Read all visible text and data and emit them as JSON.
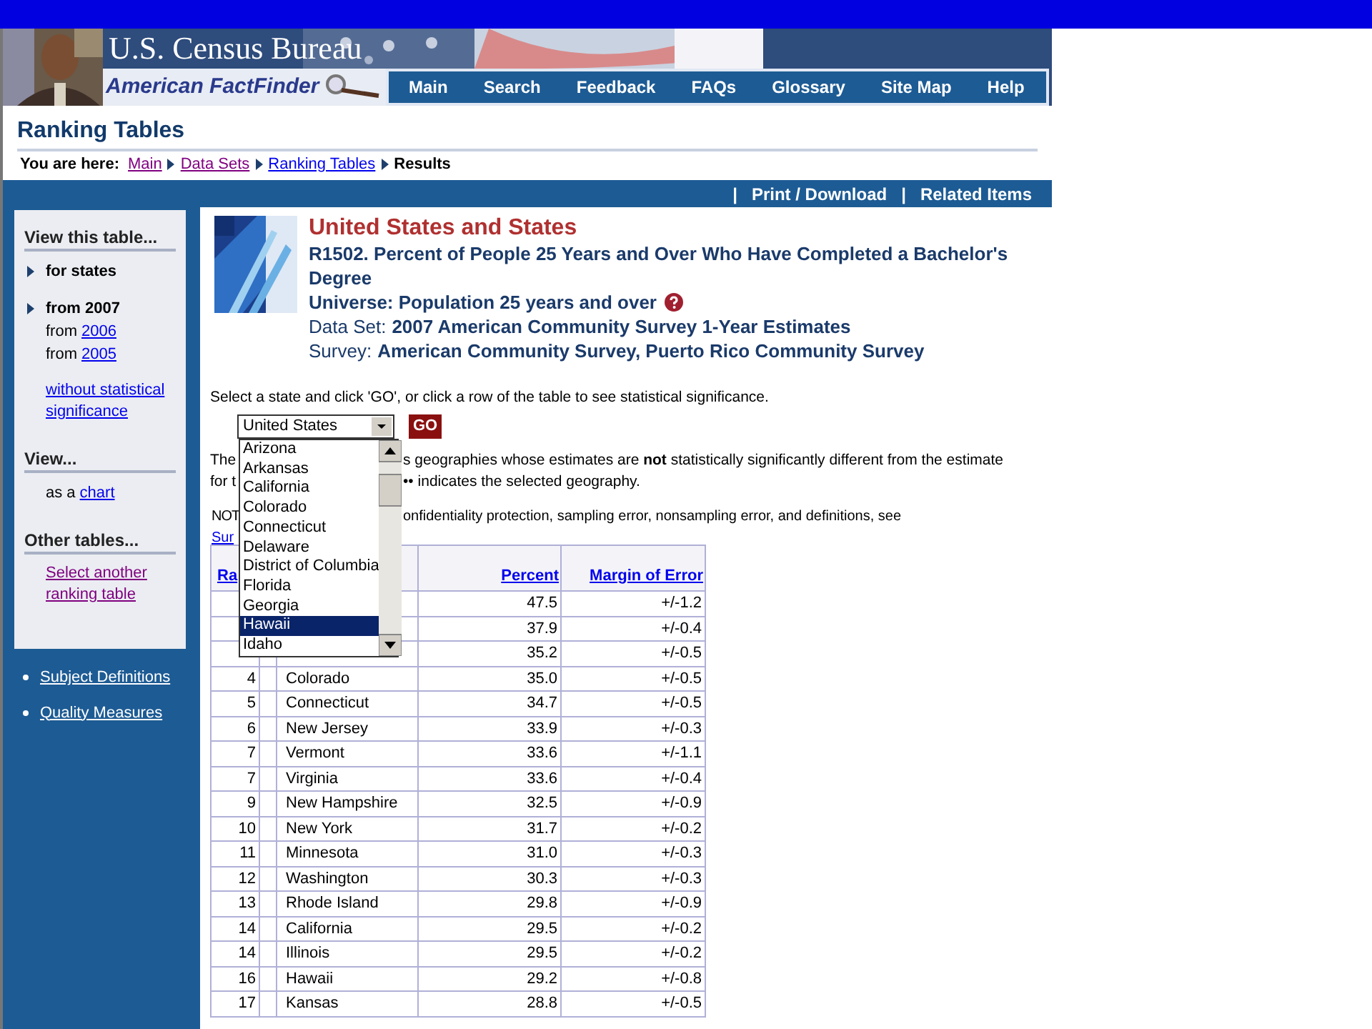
{
  "header": {
    "site_title": "U.S. Census Bureau",
    "product": "American FactFinder",
    "nav": [
      "Main",
      "Search",
      "Feedback",
      "FAQs",
      "Glossary",
      "Site Map",
      "Help"
    ]
  },
  "page_title": "Ranking Tables",
  "breadcrumb": {
    "label": "You are here:",
    "links": [
      {
        "text": "Main",
        "visited": true
      },
      {
        "text": "Data Sets",
        "visited": true
      },
      {
        "text": "Ranking Tables",
        "visited": false
      }
    ],
    "current": "Results"
  },
  "toolbar": [
    {
      "separator": "|",
      "text": "Print / Download"
    },
    {
      "separator": "|",
      "text": "Related Items"
    }
  ],
  "sidebar": {
    "sections": [
      {
        "heading": "View this table...",
        "groups": [
          [
            {
              "kind": "current",
              "text": "for states"
            }
          ],
          [
            {
              "kind": "current",
              "text": "from 2007"
            },
            {
              "kind": "text_link",
              "text": "from",
              "link": "2006",
              "visited": false
            },
            {
              "kind": "text_link",
              "text": "from",
              "link": "2005",
              "visited": false
            }
          ],
          [
            {
              "kind": "link",
              "link": "without statistical significance",
              "visited": false
            }
          ]
        ]
      },
      {
        "heading": "View...",
        "groups": [
          [
            {
              "kind": "text_link",
              "text": "as a",
              "link": "chart",
              "visited": false
            }
          ]
        ]
      },
      {
        "heading": "Other tables...",
        "groups": [
          [
            {
              "kind": "link",
              "link": "Select another ranking table",
              "visited": true
            }
          ]
        ]
      }
    ],
    "footer_links": [
      "Subject Definitions",
      "Quality Measures"
    ]
  },
  "report": {
    "geography": "United States and States",
    "table_title": "R1502. Percent of People 25 Years and Over Who Have Completed a Bachelor's Degree",
    "universe": "Universe: Population 25 years and over",
    "data_set": {
      "label": "Data Set:",
      "value": "2007 American Community Survey 1-Year Estimates"
    },
    "survey": {
      "label": "Survey:",
      "value": "American Community Survey, Puerto Rico Community Survey"
    }
  },
  "instruction": "Select a state and click 'GO', or click a row of the table to see statistical significance.",
  "state_select": {
    "value": "United States",
    "button": "GO",
    "options": [
      {
        "label": "Arizona",
        "selected": false
      },
      {
        "label": "Arkansas",
        "selected": false
      },
      {
        "label": "California",
        "selected": false
      },
      {
        "label": "Colorado",
        "selected": false
      },
      {
        "label": "Connecticut",
        "selected": false
      },
      {
        "label": "Delaware",
        "selected": false
      },
      {
        "label": "District of Columbia",
        "selected": false
      },
      {
        "label": "Florida",
        "selected": false
      },
      {
        "label": "Georgia",
        "selected": false
      },
      {
        "label": "Hawaii",
        "selected": true
      },
      {
        "label": "Idaho",
        "selected": false
      }
    ]
  },
  "notes": [
    {
      "left": "The",
      "right": "s geographies whose estimates are **not** statistically significantly different from the estimate"
    },
    {
      "left": "for t",
      "right": "•• indicates the selected geography."
    }
  ],
  "note2": [
    {
      "left": "NOT",
      "right": "onfidentiality protection, sampling error, nonsampling error, and definitions, see"
    },
    {
      "link": "Sur"
    }
  ],
  "table": {
    "columns": [
      {
        "label": "Ra"
      },
      {},
      {},
      {
        "label": "Percent"
      },
      {
        "label": "Margin of Error"
      }
    ],
    "rows": [
      {
        "percent": "47.5",
        "moe": "+/-1.2"
      },
      {
        "percent": "37.9",
        "moe": "+/-0.4"
      },
      {
        "percent": "35.2",
        "moe": "+/-0.5"
      },
      {
        "rank": "4",
        "name": "Colorado",
        "percent": "35.0",
        "moe": "+/-0.5"
      },
      {
        "rank": "5",
        "name": "Connecticut",
        "percent": "34.7",
        "moe": "+/-0.5"
      },
      {
        "rank": "6",
        "name": "New Jersey",
        "percent": "33.9",
        "moe": "+/-0.3"
      },
      {
        "rank": "7",
        "name": "Vermont",
        "percent": "33.6",
        "moe": "+/-1.1"
      },
      {
        "rank": "7",
        "name": "Virginia",
        "percent": "33.6",
        "moe": "+/-0.4"
      },
      {
        "rank": "9",
        "name": "New Hampshire",
        "percent": "32.5",
        "moe": "+/-0.9"
      },
      {
        "rank": "10",
        "name": "New York",
        "percent": "31.7",
        "moe": "+/-0.2"
      },
      {
        "rank": "11",
        "name": "Minnesota",
        "percent": "31.0",
        "moe": "+/-0.3"
      },
      {
        "rank": "12",
        "name": "Washington",
        "percent": "30.3",
        "moe": "+/-0.3"
      },
      {
        "rank": "13",
        "name": "Rhode Island",
        "percent": "29.8",
        "moe": "+/-0.9"
      },
      {
        "rank": "14",
        "name": "California",
        "percent": "29.5",
        "moe": "+/-0.2"
      },
      {
        "rank": "14",
        "name": "Illinois",
        "percent": "29.5",
        "moe": "+/-0.2"
      },
      {
        "rank": "16",
        "name": "Hawaii",
        "percent": "29.2",
        "moe": "+/-0.8"
      },
      {
        "rank": "17",
        "name": "Kansas",
        "percent": "28.8",
        "moe": "+/-0.5"
      }
    ]
  }
}
